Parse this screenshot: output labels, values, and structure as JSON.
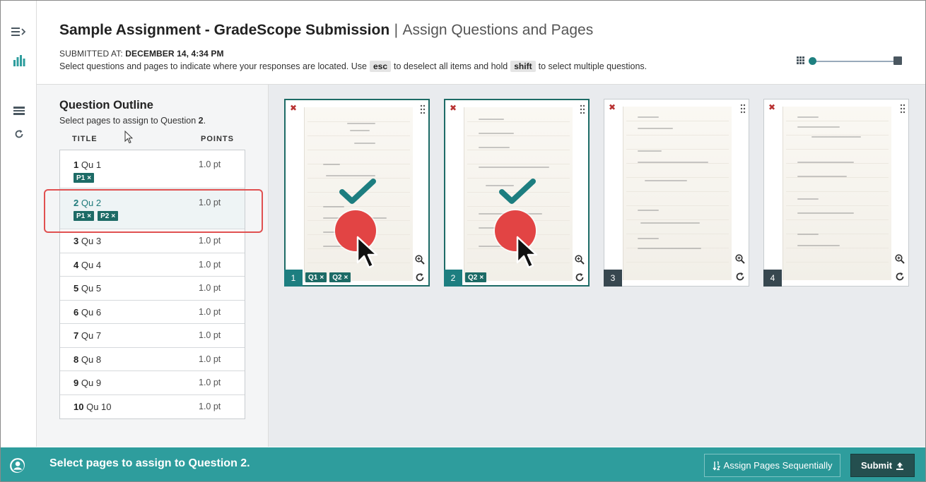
{
  "header": {
    "assignment_title": "Sample Assignment - GradeScope Submission",
    "separator": "|",
    "page_subtitle": "Assign Questions and Pages",
    "submitted_label": "SUBMITTED AT:",
    "submitted_value": "DECEMBER 14, 4:34 PM",
    "instr_part1": "Select questions and pages to indicate where your responses are located. Use",
    "key_esc": "esc",
    "instr_part2": "to deselect all items and hold",
    "key_shift": "shift",
    "instr_part3": "to select multiple questions."
  },
  "outline": {
    "title": "Question Outline",
    "hint_prefix": "Select pages to assign to Question",
    "hint_number": "2",
    "hint_suffix": ".",
    "col_title": "TITLE",
    "col_points": "POINTS",
    "questions": [
      {
        "num": "1",
        "name": "Qu 1",
        "points": "1.0 pt",
        "tags": [
          "P1"
        ]
      },
      {
        "num": "2",
        "name": "Qu 2",
        "points": "1.0 pt",
        "tags": [
          "P1",
          "P2"
        ]
      },
      {
        "num": "3",
        "name": "Qu 3",
        "points": "1.0 pt"
      },
      {
        "num": "4",
        "name": "Qu 4",
        "points": "1.0 pt"
      },
      {
        "num": "5",
        "name": "Qu 5",
        "points": "1.0 pt"
      },
      {
        "num": "6",
        "name": "Qu 6",
        "points": "1.0 pt"
      },
      {
        "num": "7",
        "name": "Qu 7",
        "points": "1.0 pt"
      },
      {
        "num": "8",
        "name": "Qu 8",
        "points": "1.0 pt"
      },
      {
        "num": "9",
        "name": "Qu 9",
        "points": "1.0 pt"
      },
      {
        "num": "10",
        "name": "Qu 10",
        "points": "1.0 pt"
      }
    ],
    "tag_remove_glyph": "×"
  },
  "pages": [
    {
      "number": "1",
      "tags": [
        "Q1",
        "Q2"
      ],
      "selected": true
    },
    {
      "number": "2",
      "tags": [
        "Q2"
      ],
      "selected": true
    },
    {
      "number": "3",
      "tags": [],
      "selected": false
    },
    {
      "number": "4",
      "tags": [],
      "selected": false
    }
  ],
  "page_remove_glyph": "✖",
  "footer": {
    "message": "Select pages to assign to Question 2.",
    "assign_seq_label": "Assign Pages Sequentially",
    "submit_label": "Submit"
  },
  "colors": {
    "accent_teal": "#2e9d9d",
    "tag_green": "#1d6b66",
    "submit_dark": "#244f4f",
    "highlight_red": "#e05050",
    "dot_red": "#e24444"
  },
  "icons": {
    "rail": [
      "menu-icon",
      "stats-icon",
      "outline-icon",
      "regrade-icon"
    ],
    "page": [
      "remove-icon",
      "drag-handle-icon",
      "zoom-icon",
      "rotate-icon"
    ],
    "footer": [
      "help-icon",
      "sort-icon",
      "upload-icon"
    ]
  }
}
